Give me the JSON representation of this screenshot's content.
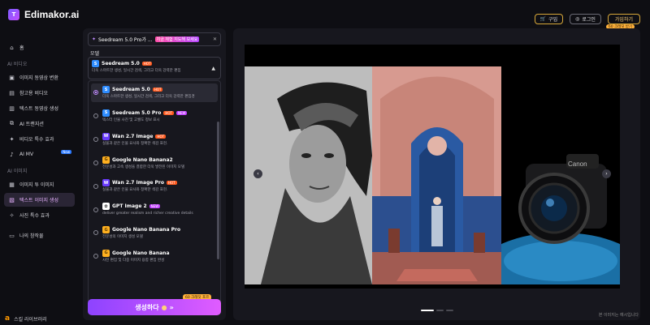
{
  "app": {
    "name": "Edimakor.ai",
    "logo_letter": "T"
  },
  "header": {
    "purchase": "구입",
    "login": "로그인",
    "signup": "가입하기",
    "signup_badge": "60 크레딧 받기"
  },
  "sidebar": {
    "home": "홈",
    "section_video": "AI 비디오",
    "video_items": [
      "이미지 동영상 변환",
      "참고용 비디오",
      "텍스트 동영상 생성",
      "AI 트랜지션",
      "비디오 특수 효과",
      "AI MV"
    ],
    "ai_mv_tag": "New",
    "section_image": "AI 이미지",
    "image_items": [
      "이미지 투 이미지",
      "텍스트 이미지 생성",
      "사진 특수 효과"
    ],
    "my_works": "나의 창작물",
    "bottom": "스킬 라이브러리"
  },
  "panel": {
    "current_model": "Seedream 5.0 Pro가 ...",
    "current_tag": "지금 체험 지도해 보세요",
    "model_label": "모델",
    "selected_name": "Seedream 5.0",
    "selected_desc": "더욱 스마트한 생성, 일시간 검색, 그리고 더욱 강력한 편집",
    "options": [
      {
        "name": "Seedream 5.0",
        "desc": "더욱 스마트한 생성, 일시간 검색, 그리고 더욱 강력한 편집경",
        "tags": [
          "HOT"
        ]
      },
      {
        "name": "Seedream 5.0 Pro",
        "desc": "텍스터 인물 사진 및 고퀄도 정보 표시",
        "tags": [
          "HOT",
          "NEW"
        ]
      },
      {
        "name": "Wan 2.7 Image",
        "desc": "실물과 같은 인물 묘사와 정확한 색감 표현.",
        "tags": [
          "HOT"
        ]
      },
      {
        "name": "Google Nano Banana2",
        "desc": "전문성과 고속 생성을 결합한 더욱 발전된 이미지 모델",
        "tags": []
      },
      {
        "name": "Wan 2.7 Image Pro",
        "desc": "실물과 같은 인물 묘사와 정확한 색감 표현.",
        "tags": [
          "HOT"
        ]
      },
      {
        "name": "GPT Image 2",
        "desc": "deliver greater realism and richer creative details",
        "tags": [
          "NEW"
        ]
      },
      {
        "name": "Google Nano Banana Pro",
        "desc": "전문성의 이미지 생성 모델",
        "tags": []
      },
      {
        "name": "Google Nano Banana",
        "desc": "사진 편집 및 다중 이미지 융합 편집 완성",
        "tags": []
      }
    ],
    "generate_label": "생성하다",
    "generate_badge": "60 크레딧 포르"
  },
  "preview": {
    "watermark": "본 이미지는 예시입니다",
    "prev": "‹",
    "next": "›"
  }
}
